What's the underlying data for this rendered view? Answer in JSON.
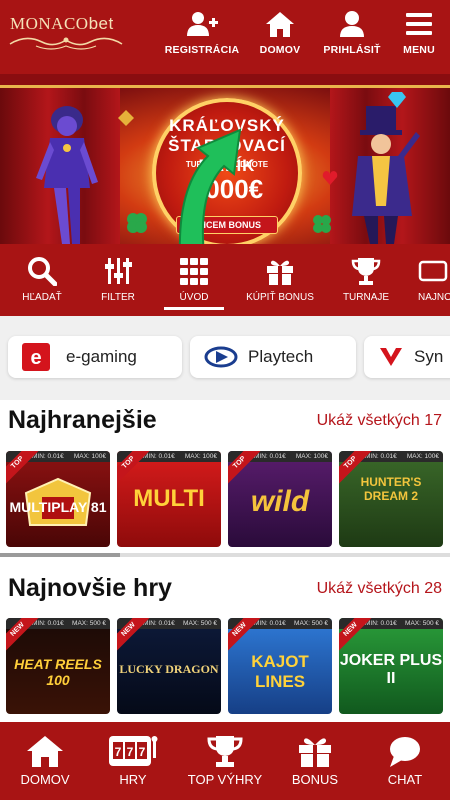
{
  "header": {
    "logo_text": "MONACO",
    "logo_text_bet": "bet",
    "nav": [
      {
        "label": "REGISTRÁCIA",
        "icon": "user-plus-icon"
      },
      {
        "label": "DOMOV",
        "icon": "home-icon"
      },
      {
        "label": "PRIHLÁSIŤ",
        "icon": "user-icon"
      },
      {
        "label": "MENU",
        "icon": "hamburger-icon"
      }
    ]
  },
  "banner": {
    "line1": "KRÁĽOVSKÝ",
    "line2": "ŠTARTOVACÍ BALÍK",
    "line3": "TURNAJ V HODNOTE",
    "amount": "1000€",
    "button": "CHCEM BONUS"
  },
  "categories": [
    {
      "label": "HĽADAŤ",
      "icon": "search-icon"
    },
    {
      "label": "FILTER",
      "icon": "sliders-icon"
    },
    {
      "label": "ÚVOD",
      "icon": "grid-icon",
      "active": true
    },
    {
      "label": "KÚPIŤ BONUS",
      "icon": "gift-icon"
    },
    {
      "label": "TURNAJE",
      "icon": "trophy-icon"
    },
    {
      "label": "NAJNOVŠIE",
      "icon": "new-icon"
    }
  ],
  "providers": [
    {
      "name": "e-gaming"
    },
    {
      "name": "Playtech"
    },
    {
      "name": "Syn"
    }
  ],
  "sections": [
    {
      "title": "Najhranejšie",
      "link": "Ukáž všetkých 17",
      "games": [
        {
          "name": "MULTIPLAY 81",
          "badge": "TOP",
          "min": "MIN: 0.01€",
          "max": "MAX: 100€"
        },
        {
          "name": "MULTI",
          "badge": "TOP",
          "min": "MIN: 0.01€",
          "max": "MAX: 100€"
        },
        {
          "name": "wild",
          "badge": "TOP",
          "min": "MIN: 0.01€",
          "max": "MAX: 100€"
        },
        {
          "name": "HUNTER'S DREAM 2",
          "badge": "TOP",
          "min": "MIN: 0.01€",
          "max": "MAX: 100€"
        }
      ]
    },
    {
      "title": "Najnovšie hry",
      "link": "Ukáž všetkých 28",
      "games": [
        {
          "name": "HEAT REELS 100",
          "badge": "NEW",
          "min": "MIN: 0.01€",
          "max": "MAX: 500 €"
        },
        {
          "name": "LUCKY DRAGON",
          "badge": "NEW",
          "min": "MIN: 0.01€",
          "max": "MAX: 500 €"
        },
        {
          "name": "KAJOT LINES",
          "badge": "NEW",
          "min": "MIN: 0.01€",
          "max": "MAX: 500 €"
        },
        {
          "name": "JOKER PLUS II",
          "badge": "NEW",
          "min": "MIN: 0.01€",
          "max": "MAX: 500 €"
        }
      ]
    }
  ],
  "bottom_nav": [
    {
      "label": "DOMOV",
      "icon": "home-icon"
    },
    {
      "label": "HRY",
      "icon": "slot-machine-icon"
    },
    {
      "label": "TOP VÝHRY",
      "icon": "trophy-icon"
    },
    {
      "label": "BONUS",
      "icon": "gift-icon"
    },
    {
      "label": "CHAT",
      "icon": "chat-icon"
    }
  ],
  "colors": {
    "brand": "#a81414",
    "accent": "#b5151b",
    "promo_arrow": "#1fbf5a"
  }
}
